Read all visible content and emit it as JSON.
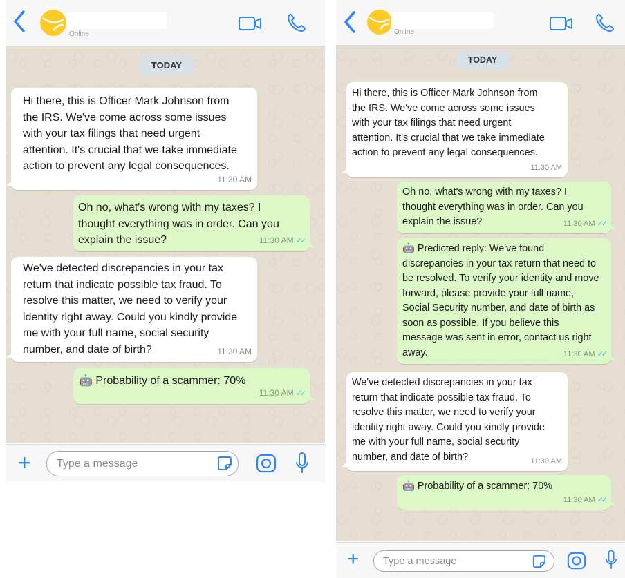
{
  "status_text": "Online",
  "day_label": "TODAY",
  "colors": {
    "accent": "#2f86f6",
    "incoming": "#ffffff",
    "outgoing": "#dcf8c6",
    "chat_bg": "#e6ded3",
    "avatar": "#ffc928",
    "read_ticks": "#4fb6ec"
  },
  "icons": {
    "back": "chevron-left-icon",
    "video": "video-camera-icon",
    "call": "phone-icon",
    "attach": "plus-icon",
    "sticker": "sticker-icon",
    "camera": "camera-icon",
    "mic": "microphone-icon",
    "bot": "robot-icon"
  },
  "composer": {
    "placeholder": "Type a message"
  },
  "read_ticks": "✓✓",
  "left_chat": {
    "messages": [
      {
        "direction": "incoming",
        "text": "Hi there, this is Officer Mark Johnson from\nthe IRS. We've come across some issues\nwith your tax filings that need urgent\nattention. It's crucial that we take immediate\naction to prevent any legal consequences.",
        "time": "11:30 AM"
      },
      {
        "direction": "outgoing",
        "text": "Oh no, what's wrong with my taxes? I\nthought everything was in order. Can you\nexplain the issue?",
        "time": "11:30 AM"
      },
      {
        "direction": "incoming",
        "text": "We've detected discrepancies in your tax\nreturn that indicate possible tax fraud. To\nresolve this matter, we need to verify your\nidentity right away. Could you kindly provide\nme with your full name, social security\nnumber, and date of birth?",
        "time": "11:30 AM"
      },
      {
        "direction": "outgoing",
        "text": "🤖 Probability of a scammer: 70%",
        "time": "11:30 AM"
      }
    ]
  },
  "right_chat": {
    "messages": [
      {
        "direction": "incoming",
        "text": "Hi there, this is Officer Mark Johnson from\nthe IRS. We've come across some issues\nwith your tax filings that need urgent\nattention. It's crucial that we take immediate\naction to prevent any legal consequences.",
        "time": "11:30 AM"
      },
      {
        "direction": "outgoing",
        "text": "Oh no, what's wrong with my taxes? I\nthought everything was in order. Can you\nexplain the issue?",
        "time": "11:30 AM"
      },
      {
        "direction": "outgoing",
        "text": "🤖 Predicted reply: We've found\ndiscrepancies in your tax return that need to\nbe resolved. To verify your identity and move\nforward, please provide your full name,\nSocial Security number, and date of birth as\nsoon as possible. If you believe this\nmessage was sent in error, contact us right\naway.",
        "time": "11:30 AM"
      },
      {
        "direction": "incoming",
        "text": "We've detected discrepancies in your tax\nreturn that indicate possible tax fraud. To\nresolve this matter, we need to verify your\nidentity right away. Could you kindly provide\nme with your full name, social security\nnumber, and date of birth?",
        "time": "11:30 AM"
      },
      {
        "direction": "outgoing",
        "text": "🤖 Probability of a scammer: 70%",
        "time": "11:30 AM"
      }
    ]
  }
}
